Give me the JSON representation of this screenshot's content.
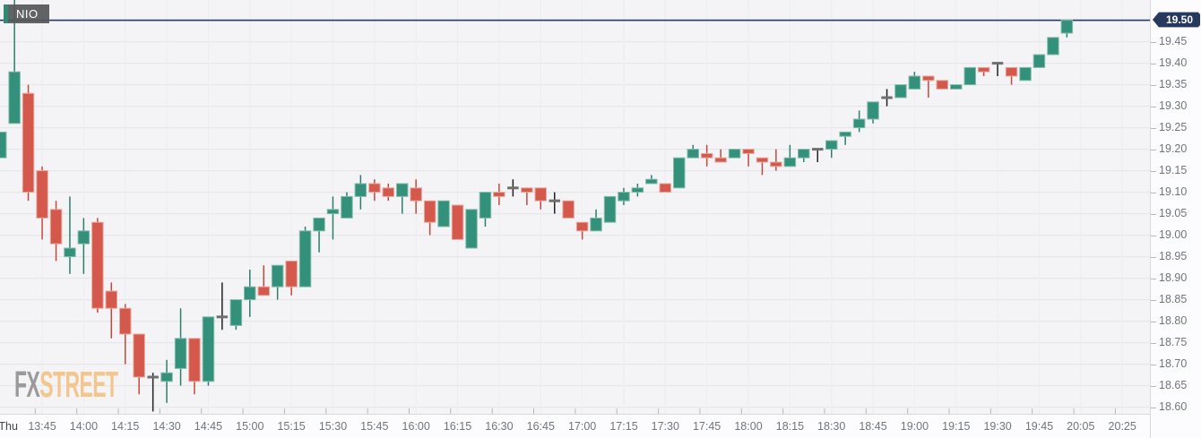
{
  "symbol_label": "NIO",
  "current_price": "19.50",
  "logo": {
    "fx": "FX",
    "street": "STREET"
  },
  "colors": {
    "background": "#f4f4f6",
    "gridline": "#e4e4e9",
    "vgridline": "#ededf1",
    "up_fill": "#33917b",
    "up_border": "#84bcab",
    "up_wick": "#2b7f6c",
    "down_fill": "#d5584c",
    "down_border": "#e9a89f",
    "down_wick": "#c3493d",
    "doji_wick": "#222222",
    "doji_bar": "#6f6f6f",
    "price_line": "#25395e",
    "badge_bg": "#25395e",
    "badge_text": "#ffffff",
    "tick": "#b3b7bd",
    "label_text": "#70757c",
    "day_text": "#42464b"
  },
  "price_axis": {
    "labels": [
      "19.45",
      "19.40",
      "19.35",
      "19.30",
      "19.25",
      "19.20",
      "19.15",
      "19.10",
      "19.05",
      "19.00",
      "18.95",
      "18.90",
      "18.85",
      "18.80",
      "18.75",
      "18.70",
      "18.65",
      "18.60"
    ]
  },
  "time_axis": {
    "labels": [
      {
        "label": "Thu",
        "slot": 0.55,
        "day": true
      },
      {
        "label": "13:45",
        "slot": 3
      },
      {
        "label": "14:00",
        "slot": 6
      },
      {
        "label": "14:15",
        "slot": 9
      },
      {
        "label": "14:30",
        "slot": 12
      },
      {
        "label": "14:45",
        "slot": 15
      },
      {
        "label": "15:00",
        "slot": 18
      },
      {
        "label": "15:15",
        "slot": 21
      },
      {
        "label": "15:30",
        "slot": 24
      },
      {
        "label": "15:45",
        "slot": 27
      },
      {
        "label": "16:00",
        "slot": 30
      },
      {
        "label": "16:15",
        "slot": 33
      },
      {
        "label": "16:30",
        "slot": 36
      },
      {
        "label": "16:45",
        "slot": 39
      },
      {
        "label": "17:00",
        "slot": 42
      },
      {
        "label": "17:15",
        "slot": 45
      },
      {
        "label": "17:30",
        "slot": 48
      },
      {
        "label": "17:45",
        "slot": 51
      },
      {
        "label": "18:00",
        "slot": 54
      },
      {
        "label": "18:15",
        "slot": 57
      },
      {
        "label": "18:30",
        "slot": 60
      },
      {
        "label": "18:45",
        "slot": 63
      },
      {
        "label": "19:00",
        "slot": 66
      },
      {
        "label": "19:15",
        "slot": 69
      },
      {
        "label": "19:30",
        "slot": 72
      },
      {
        "label": "19:45",
        "slot": 75
      },
      {
        "label": "20:05",
        "slot": 78
      },
      {
        "label": "20:25",
        "slot": 81
      }
    ]
  },
  "chart_data": {
    "type": "candlestick",
    "symbol": "NIO",
    "interval_minutes": 5,
    "ylim": [
      18.585,
      19.547
    ],
    "last_price": 19.5,
    "candles": [
      {
        "t": "13:30",
        "o": 19.18,
        "h": 19.24,
        "l": 19.18,
        "c": 19.24
      },
      {
        "t": "13:35",
        "o": 19.26,
        "h": 19.55,
        "l": 19.26,
        "c": 19.38
      },
      {
        "t": "13:40",
        "o": 19.33,
        "h": 19.35,
        "l": 19.08,
        "c": 19.1
      },
      {
        "t": "13:45",
        "o": 19.15,
        "h": 19.16,
        "l": 18.99,
        "c": 19.04
      },
      {
        "t": "13:50",
        "o": 19.06,
        "h": 19.08,
        "l": 18.94,
        "c": 18.98
      },
      {
        "t": "13:55",
        "o": 18.95,
        "h": 19.09,
        "l": 18.91,
        "c": 18.97
      },
      {
        "t": "14:00",
        "o": 18.98,
        "h": 19.04,
        "l": 18.91,
        "c": 19.01
      },
      {
        "t": "14:05",
        "o": 19.03,
        "h": 19.04,
        "l": 18.82,
        "c": 18.83
      },
      {
        "t": "14:10",
        "o": 18.87,
        "h": 18.89,
        "l": 18.76,
        "c": 18.83
      },
      {
        "t": "14:15",
        "o": 18.83,
        "h": 18.84,
        "l": 18.7,
        "c": 18.77
      },
      {
        "t": "14:20",
        "o": 18.77,
        "h": 18.77,
        "l": 18.63,
        "c": 18.67
      },
      {
        "t": "14:25",
        "o": 18.67,
        "h": 18.68,
        "l": 18.59,
        "c": 18.67,
        "doji": true
      },
      {
        "t": "14:30",
        "o": 18.66,
        "h": 18.71,
        "l": 18.61,
        "c": 18.68
      },
      {
        "t": "14:35",
        "o": 18.69,
        "h": 18.83,
        "l": 18.65,
        "c": 18.76
      },
      {
        "t": "14:40",
        "o": 18.76,
        "h": 18.76,
        "l": 18.63,
        "c": 18.66
      },
      {
        "t": "14:45",
        "o": 18.66,
        "h": 18.81,
        "l": 18.65,
        "c": 18.81
      },
      {
        "t": "14:50",
        "o": 18.81,
        "h": 18.89,
        "l": 18.78,
        "c": 18.81,
        "doji": true
      },
      {
        "t": "14:55",
        "o": 18.79,
        "h": 18.85,
        "l": 18.78,
        "c": 18.85
      },
      {
        "t": "15:00",
        "o": 18.85,
        "h": 18.92,
        "l": 18.81,
        "c": 18.88
      },
      {
        "t": "15:05",
        "o": 18.88,
        "h": 18.93,
        "l": 18.86,
        "c": 18.86
      },
      {
        "t": "15:10",
        "o": 18.88,
        "h": 18.93,
        "l": 18.85,
        "c": 18.93
      },
      {
        "t": "15:15",
        "o": 18.94,
        "h": 18.94,
        "l": 18.86,
        "c": 18.88
      },
      {
        "t": "15:20",
        "o": 18.88,
        "h": 19.02,
        "l": 18.88,
        "c": 19.01
      },
      {
        "t": "15:25",
        "o": 19.01,
        "h": 19.04,
        "l": 18.96,
        "c": 19.04
      },
      {
        "t": "15:30",
        "o": 19.05,
        "h": 19.09,
        "l": 18.99,
        "c": 19.06
      },
      {
        "t": "15:35",
        "o": 19.04,
        "h": 19.1,
        "l": 19.04,
        "c": 19.09
      },
      {
        "t": "15:40",
        "o": 19.09,
        "h": 19.14,
        "l": 19.06,
        "c": 19.12
      },
      {
        "t": "15:45",
        "o": 19.12,
        "h": 19.13,
        "l": 19.08,
        "c": 19.1
      },
      {
        "t": "15:50",
        "o": 19.11,
        "h": 19.12,
        "l": 19.08,
        "c": 19.09
      },
      {
        "t": "15:55",
        "o": 19.09,
        "h": 19.12,
        "l": 19.05,
        "c": 19.12
      },
      {
        "t": "16:00",
        "o": 19.11,
        "h": 19.13,
        "l": 19.05,
        "c": 19.08
      },
      {
        "t": "16:05",
        "o": 19.08,
        "h": 19.08,
        "l": 19.0,
        "c": 19.03
      },
      {
        "t": "16:10",
        "o": 19.02,
        "h": 19.08,
        "l": 19.02,
        "c": 19.08
      },
      {
        "t": "16:15",
        "o": 19.07,
        "h": 19.07,
        "l": 18.99,
        "c": 18.99
      },
      {
        "t": "16:20",
        "o": 18.97,
        "h": 19.06,
        "l": 18.97,
        "c": 19.06
      },
      {
        "t": "16:25",
        "o": 19.04,
        "h": 19.1,
        "l": 19.02,
        "c": 19.1
      },
      {
        "t": "16:30",
        "o": 19.1,
        "h": 19.12,
        "l": 19.07,
        "c": 19.09
      },
      {
        "t": "16:35",
        "o": 19.11,
        "h": 19.13,
        "l": 19.09,
        "c": 19.11,
        "doji": true
      },
      {
        "t": "16:40",
        "o": 19.11,
        "h": 19.11,
        "l": 19.07,
        "c": 19.1
      },
      {
        "t": "16:45",
        "o": 19.11,
        "h": 19.11,
        "l": 19.06,
        "c": 19.08
      },
      {
        "t": "16:50",
        "o": 19.08,
        "h": 19.1,
        "l": 19.05,
        "c": 19.08,
        "doji": true
      },
      {
        "t": "16:55",
        "o": 19.08,
        "h": 19.08,
        "l": 19.04,
        "c": 19.04
      },
      {
        "t": "17:00",
        "o": 19.03,
        "h": 19.03,
        "l": 18.99,
        "c": 19.01
      },
      {
        "t": "17:05",
        "o": 19.01,
        "h": 19.06,
        "l": 19.01,
        "c": 19.04
      },
      {
        "t": "17:10",
        "o": 19.03,
        "h": 19.09,
        "l": 19.03,
        "c": 19.09
      },
      {
        "t": "17:15",
        "o": 19.08,
        "h": 19.11,
        "l": 19.07,
        "c": 19.1
      },
      {
        "t": "17:20",
        "o": 19.1,
        "h": 19.12,
        "l": 19.09,
        "c": 19.11
      },
      {
        "t": "17:25",
        "o": 19.12,
        "h": 19.14,
        "l": 19.12,
        "c": 19.13
      },
      {
        "t": "17:30",
        "o": 19.12,
        "h": 19.12,
        "l": 19.1,
        "c": 19.1
      },
      {
        "t": "17:35",
        "o": 19.11,
        "h": 19.18,
        "l": 19.11,
        "c": 19.18
      },
      {
        "t": "17:40",
        "o": 19.18,
        "h": 19.21,
        "l": 19.18,
        "c": 19.2
      },
      {
        "t": "17:45",
        "o": 19.19,
        "h": 19.21,
        "l": 19.16,
        "c": 19.18
      },
      {
        "t": "17:50",
        "o": 19.18,
        "h": 19.2,
        "l": 19.17,
        "c": 19.17
      },
      {
        "t": "17:55",
        "o": 19.18,
        "h": 19.2,
        "l": 19.18,
        "c": 19.2
      },
      {
        "t": "18:00",
        "o": 19.2,
        "h": 19.2,
        "l": 19.16,
        "c": 19.19
      },
      {
        "t": "18:05",
        "o": 19.18,
        "h": 19.18,
        "l": 19.14,
        "c": 19.17
      },
      {
        "t": "18:10",
        "o": 19.17,
        "h": 19.2,
        "l": 19.15,
        "c": 19.16
      },
      {
        "t": "18:15",
        "o": 19.16,
        "h": 19.21,
        "l": 19.16,
        "c": 19.18
      },
      {
        "t": "18:20",
        "o": 19.18,
        "h": 19.2,
        "l": 19.17,
        "c": 19.2
      },
      {
        "t": "18:25",
        "o": 19.2,
        "h": 19.2,
        "l": 19.17,
        "c": 19.2,
        "doji": true
      },
      {
        "t": "18:30",
        "o": 19.2,
        "h": 19.22,
        "l": 19.18,
        "c": 19.22
      },
      {
        "t": "18:35",
        "o": 19.23,
        "h": 19.24,
        "l": 19.21,
        "c": 19.24
      },
      {
        "t": "18:40",
        "o": 19.25,
        "h": 19.29,
        "l": 19.24,
        "c": 19.27
      },
      {
        "t": "18:45",
        "o": 19.27,
        "h": 19.31,
        "l": 19.26,
        "c": 19.31
      },
      {
        "t": "18:50",
        "o": 19.32,
        "h": 19.34,
        "l": 19.3,
        "c": 19.32,
        "doji": true
      },
      {
        "t": "18:55",
        "o": 19.32,
        "h": 19.35,
        "l": 19.32,
        "c": 19.35
      },
      {
        "t": "19:00",
        "o": 19.34,
        "h": 19.38,
        "l": 19.34,
        "c": 19.37
      },
      {
        "t": "19:05",
        "o": 19.37,
        "h": 19.37,
        "l": 19.32,
        "c": 19.36
      },
      {
        "t": "19:10",
        "o": 19.36,
        "h": 19.36,
        "l": 19.34,
        "c": 19.34
      },
      {
        "t": "19:15",
        "o": 19.34,
        "h": 19.35,
        "l": 19.34,
        "c": 19.35
      },
      {
        "t": "19:20",
        "o": 19.35,
        "h": 19.39,
        "l": 19.35,
        "c": 19.39
      },
      {
        "t": "19:25",
        "o": 19.39,
        "h": 19.39,
        "l": 19.37,
        "c": 19.38
      },
      {
        "t": "19:30",
        "o": 19.4,
        "h": 19.4,
        "l": 19.37,
        "c": 19.4,
        "doji": true
      },
      {
        "t": "19:35",
        "o": 19.39,
        "h": 19.39,
        "l": 19.35,
        "c": 19.37
      },
      {
        "t": "19:40",
        "o": 19.36,
        "h": 19.39,
        "l": 19.36,
        "c": 19.39
      },
      {
        "t": "19:45",
        "o": 19.39,
        "h": 19.42,
        "l": 19.39,
        "c": 19.42
      },
      {
        "t": "19:50",
        "o": 19.42,
        "h": 19.46,
        "l": 19.42,
        "c": 19.46
      },
      {
        "t": "19:55",
        "o": 19.47,
        "h": 19.5,
        "l": 19.46,
        "c": 19.5
      }
    ]
  }
}
